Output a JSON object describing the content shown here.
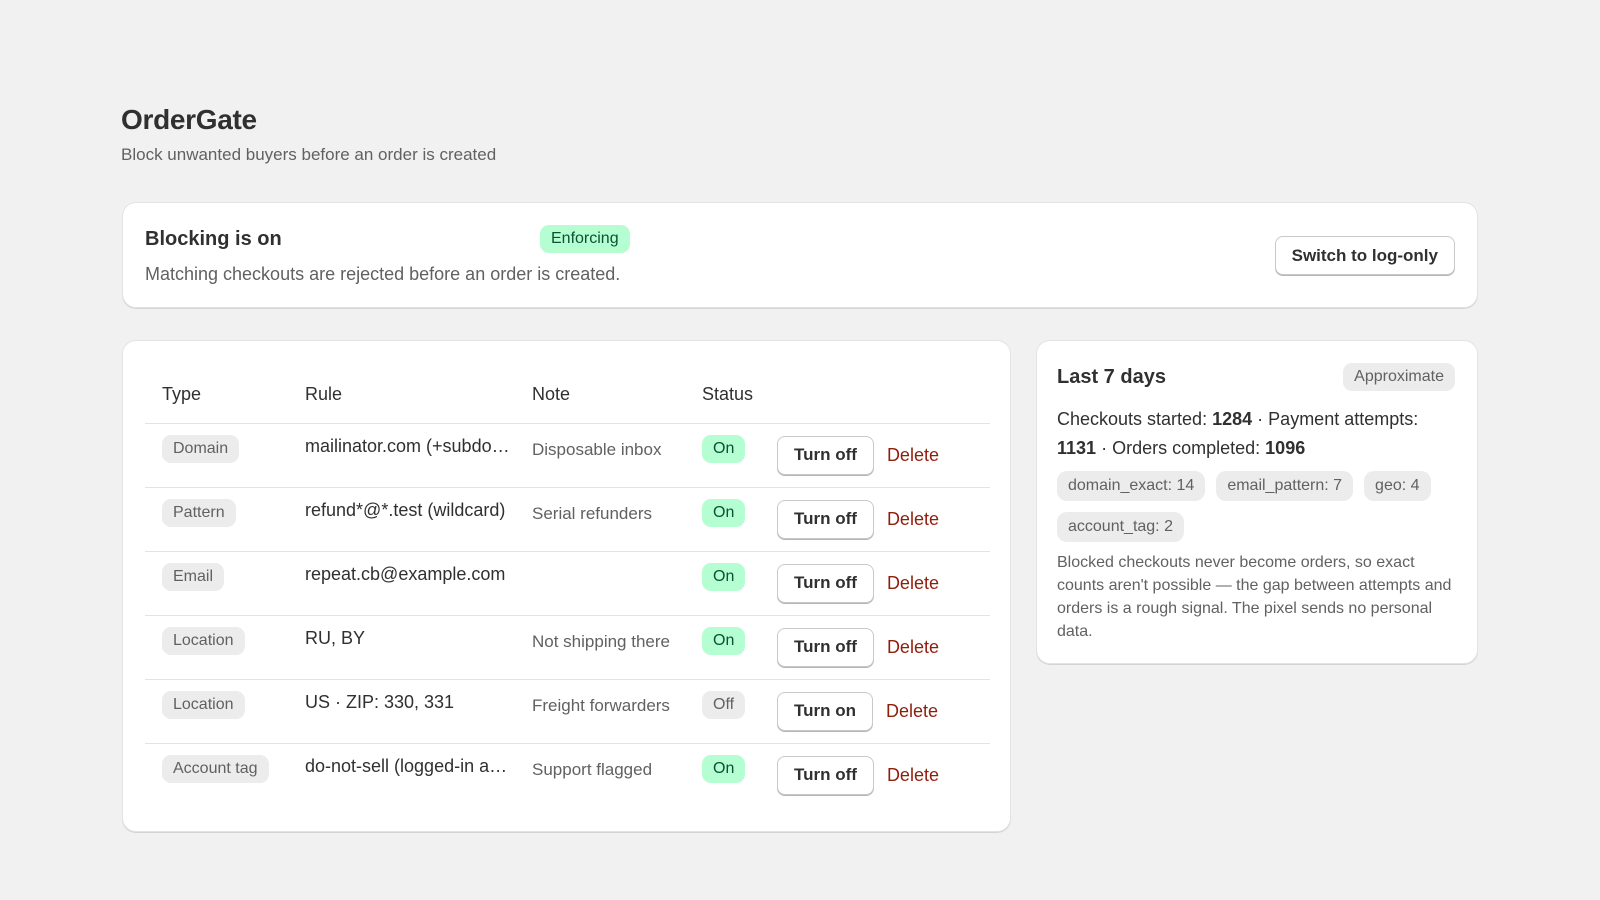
{
  "app": {
    "title": "OrderGate",
    "subtitle": "Block unwanted buyers before an order is created"
  },
  "banner": {
    "title": "Blocking is on",
    "badge": "Enforcing",
    "description": "Matching checkouts are rejected before an order is created.",
    "action_label": "Switch to log-only"
  },
  "rules": {
    "columns": [
      "Type",
      "Rule",
      "Note",
      "Status"
    ],
    "rows": [
      {
        "type": "Domain",
        "rule": "mailinator.com (+subdomains)",
        "note": "Disposable inbox",
        "status": "On",
        "toggle": "Turn off",
        "delete": "Delete"
      },
      {
        "type": "Pattern",
        "rule": "refund*@*.test (wildcard)",
        "note": "Serial refunders",
        "status": "On",
        "toggle": "Turn off",
        "delete": "Delete"
      },
      {
        "type": "Email",
        "rule": "repeat.cb@example.com",
        "note": "",
        "status": "On",
        "toggle": "Turn off",
        "delete": "Delete"
      },
      {
        "type": "Location",
        "rule": "RU, BY",
        "note": "Not shipping there",
        "status": "On",
        "toggle": "Turn off",
        "delete": "Delete"
      },
      {
        "type": "Location",
        "rule": "US · ZIP: 330, 331",
        "note": "Freight forwarders",
        "status": "Off",
        "toggle": "Turn on",
        "delete": "Delete"
      },
      {
        "type": "Account tag",
        "rule": "do-not-sell (logged-in accounts)",
        "note": "Support flagged",
        "status": "On",
        "toggle": "Turn off",
        "delete": "Delete"
      }
    ]
  },
  "stats": {
    "title": "Last 7 days",
    "badge": "Approximate",
    "checkouts_label": "Checkouts started:",
    "checkouts_value": "1284",
    "payments_label": "Payment attempts:",
    "payments_value": "1131",
    "orders_label": "Orders completed:",
    "orders_value": "1096",
    "reasons": [
      "domain_exact: 14",
      "email_pattern: 7",
      "geo: 4",
      "account_tag: 2"
    ],
    "note": "Blocked checkouts never become orders, so exact counts aren't possible — the gap between attempts and orders is a rough signal. The pixel sends no personal data."
  },
  "colors": {
    "background": "#f1f1f1",
    "success_bg": "#b4fed2",
    "success_text": "#0c5132",
    "neutral_badge_bg": "#ececec",
    "critical_link": "#8e1f0b"
  }
}
